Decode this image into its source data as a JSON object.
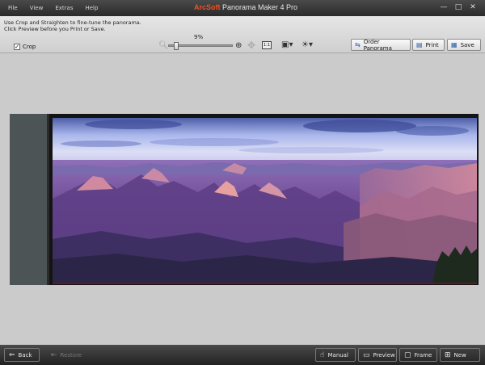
{
  "menu": {
    "items": [
      "File",
      "View",
      "Extras",
      "Help"
    ]
  },
  "title": {
    "brand": "ArcSoft",
    "rest": " Panorama Maker 4 Pro"
  },
  "window_controls": [
    "—",
    "□",
    "✕"
  ],
  "toolbar": {
    "instruction_line1": "Use Crop and Straighten to fine-tune the panorama.",
    "instruction_line2": "Click Preview before you Print or Save.",
    "crop_label": "Crop",
    "crop_checked": true,
    "zoom_percent": "9%",
    "zoom_value": 0.09,
    "fit_label": "1:1",
    "order_label": "Order Panorama",
    "print_label": "Print",
    "save_label": "Save"
  },
  "bottom": {
    "back_label": "Back",
    "restore_label": "Restore",
    "manual_label": "Manual",
    "preview_label": "Preview",
    "frame_label": "Frame",
    "new_label": "New"
  },
  "colors": {
    "brand_accent": "#e8532a",
    "titlebar": "#333333",
    "workspace": "#cbcbcb"
  }
}
